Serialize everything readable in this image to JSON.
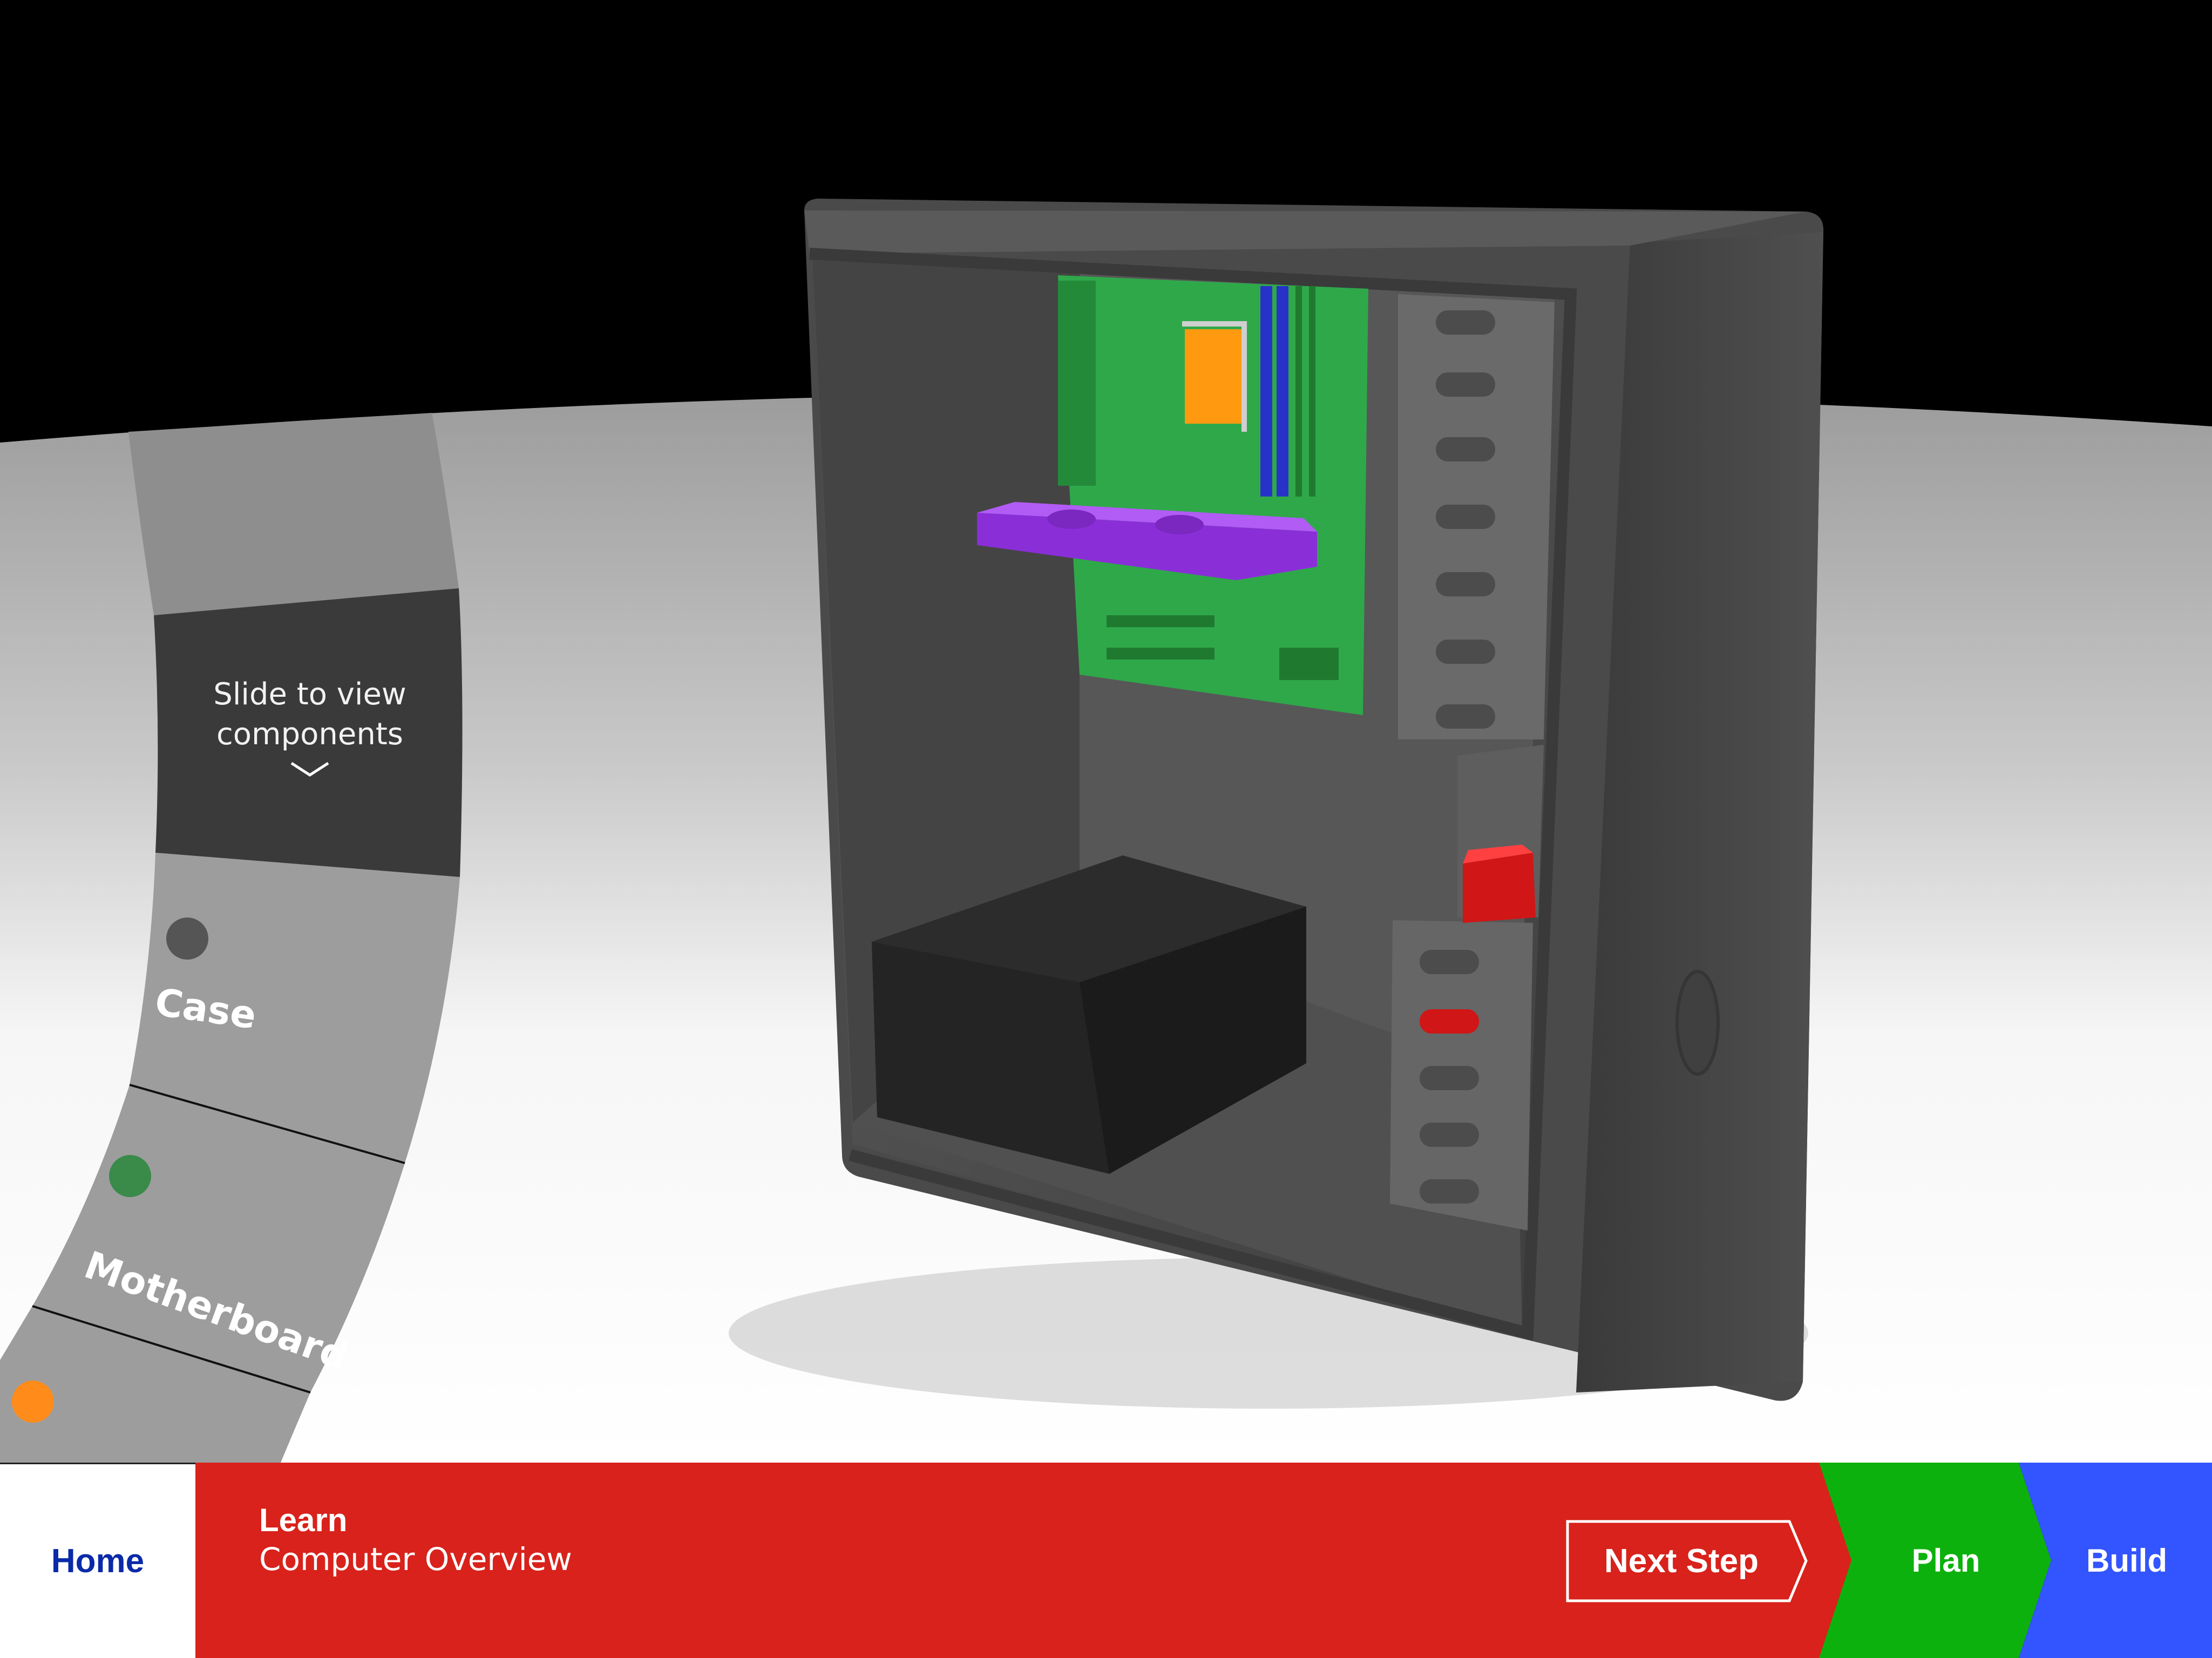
{
  "wheel": {
    "hint": "Slide to view components",
    "components": [
      {
        "label": "Case",
        "color": "#555555"
      },
      {
        "label": "Motherboard",
        "color": "#3a8a4a"
      },
      {
        "label": "",
        "color": "#ff8c1a"
      }
    ]
  },
  "scene": {
    "background": "#000000",
    "floor": "#f0f0f0",
    "case_color": "#4a4a4a",
    "motherboard_color": "#2fa84a",
    "cpu_color": "#ff9a10",
    "ram_color": "#2733c8",
    "gpu_color": "#9a3cf0",
    "drive_color": "#e81c1c",
    "psu_color": "#222222"
  },
  "navbar": {
    "home_label": "Home",
    "learn_title": "Learn",
    "learn_subtitle": "Computer Overview",
    "next_step_label": "Next Step",
    "plan_label": "Plan",
    "build_label": "Build",
    "colors": {
      "home": "#ffffff",
      "learn": "#d8221b",
      "plan": "#0db10d",
      "build": "#3355ff"
    }
  }
}
